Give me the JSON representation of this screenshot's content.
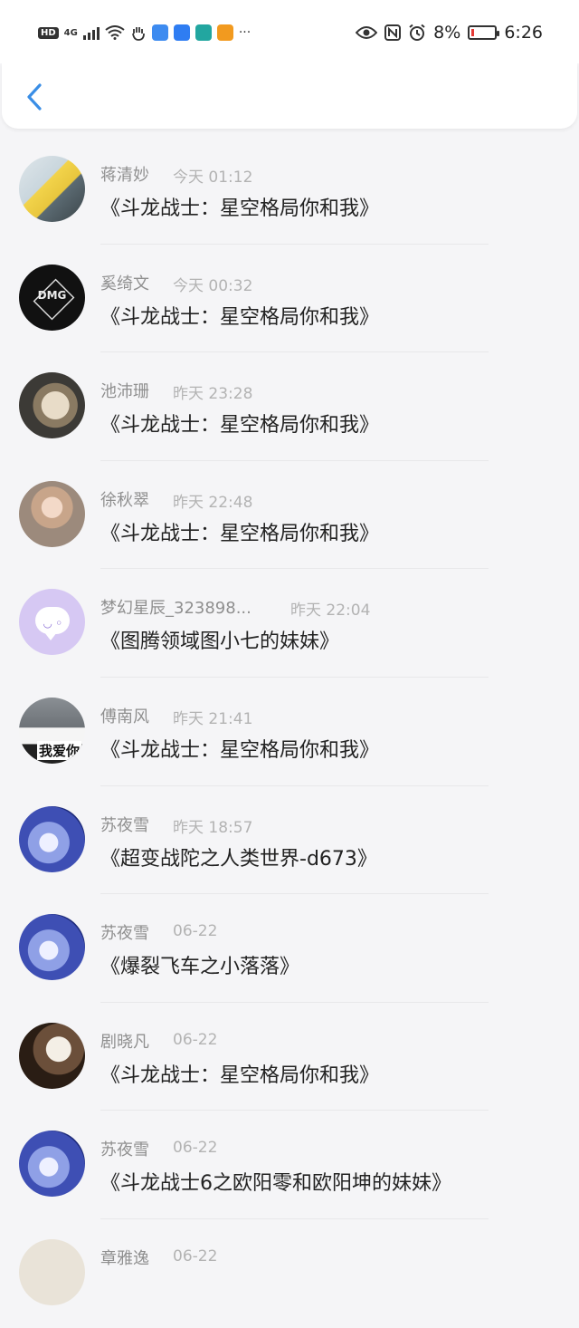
{
  "status_bar": {
    "left_badges": [
      "HD",
      "4G"
    ],
    "battery_percent": "8%",
    "time": "6:26",
    "more_dots": "···"
  },
  "header": {
    "back_icon": "chevron-left-icon"
  },
  "messages": [
    {
      "name": "蒋清妙",
      "time": "今天 01:12",
      "title": "《斗龙战士：星空格局你和我》"
    },
    {
      "name": "奚绮文",
      "time": "今天 00:32",
      "title": "《斗龙战士：星空格局你和我》",
      "avatar_text": "DMG"
    },
    {
      "name": "池沛珊",
      "time": "昨天 23:28",
      "title": "《斗龙战士：星空格局你和我》"
    },
    {
      "name": "徐秋翠",
      "time": "昨天 22:48",
      "title": "《斗龙战士：星空格局你和我》"
    },
    {
      "name": "梦幻星辰_323898...",
      "time": "昨天 22:04",
      "title": "《图腾领域图小七的妹妹》",
      "avatar_text": "◡ ◦"
    },
    {
      "name": "傅南风",
      "time": "昨天 21:41",
      "title": "《斗龙战士：星空格局你和我》",
      "avatar_text": "我爱你"
    },
    {
      "name": "苏夜雪",
      "time": "昨天 18:57",
      "title": "《超变战陀之人类世界-d673》"
    },
    {
      "name": "苏夜雪",
      "time": "06-22",
      "title": "《爆裂飞车之小落落》"
    },
    {
      "name": "剧晓凡",
      "time": "06-22",
      "title": "《斗龙战士：星空格局你和我》"
    },
    {
      "name": "苏夜雪",
      "time": "06-22",
      "title": "《斗龙战士6之欧阳零和欧阳坤的妹妹》"
    },
    {
      "name": "章雅逸",
      "time": "06-22",
      "title": ""
    }
  ]
}
